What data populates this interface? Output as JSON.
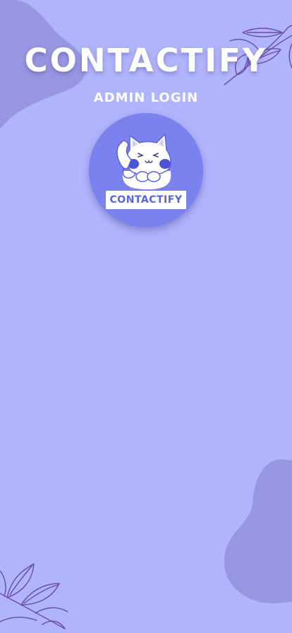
{
  "app": {
    "title": "CONTACTIFY",
    "subtitle": "ADMIN LOGIN",
    "logo_text": "CONTACTIFY"
  },
  "icons": {
    "logo": "cat-with-phone-icon",
    "decorations": [
      "leaf-branch-icon",
      "blob-shape"
    ]
  },
  "colors": {
    "background": "#b0b4fb",
    "blob": "#9896e0",
    "logo_circle": "#7b82ee",
    "title_text": "#ffffff",
    "logo_text": "#5a63e3",
    "leaf_stroke": "#6a4aa8"
  }
}
